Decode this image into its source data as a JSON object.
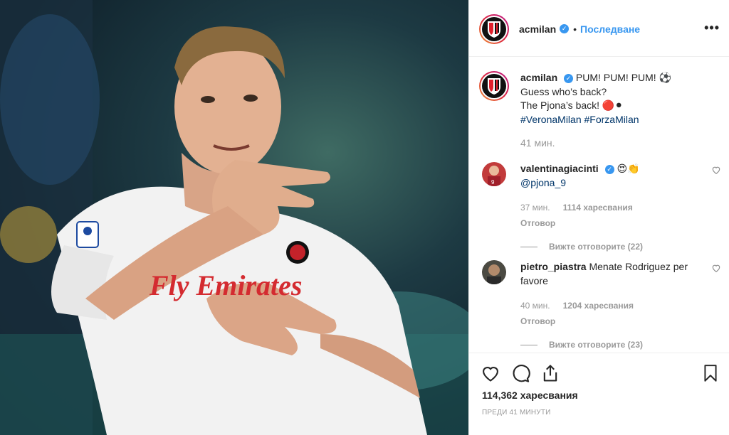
{
  "post": {
    "username": "acmilan",
    "follow_label": "Последване",
    "separator": "•",
    "more_label": "•••"
  },
  "caption": {
    "username": "acmilan",
    "line1": "PUM! PUM! PUM! ⚽",
    "line2": "Guess who’s back?",
    "line3": "The Pjona’s back! 🔴⚫",
    "hashtags": "#VeronaMilan #ForzaMilan",
    "time": "41 мин."
  },
  "comments": [
    {
      "username": "valentinagiacinti",
      "text": "😍👏",
      "mention": "@pjona_9",
      "time": "37 мин.",
      "likes": "1114 харесвания",
      "reply_label": "Отговор",
      "view_replies": "Вижте отговорите (22)"
    },
    {
      "username": "pietro_piastra",
      "text": "Menate Rodriguez per favore",
      "time": "40 мин.",
      "likes": "1204 харесвания",
      "reply_label": "Отговор",
      "view_replies": "Вижте отговорите (23)"
    }
  ],
  "footer": {
    "likes": "114,362 харесвания",
    "posted": "ПРЕДИ 41 МИНУТИ"
  },
  "photo": {
    "jersey_sponsor": "Fly Emirates"
  },
  "icons": {
    "like": "heart-icon",
    "comment": "comment-icon",
    "share": "share-icon",
    "save": "bookmark-icon",
    "verified": "verified-badge-icon"
  },
  "colors": {
    "link": "#3897f0",
    "hashtag": "#003569",
    "muted": "#999999",
    "milan_red": "#e0202c"
  }
}
